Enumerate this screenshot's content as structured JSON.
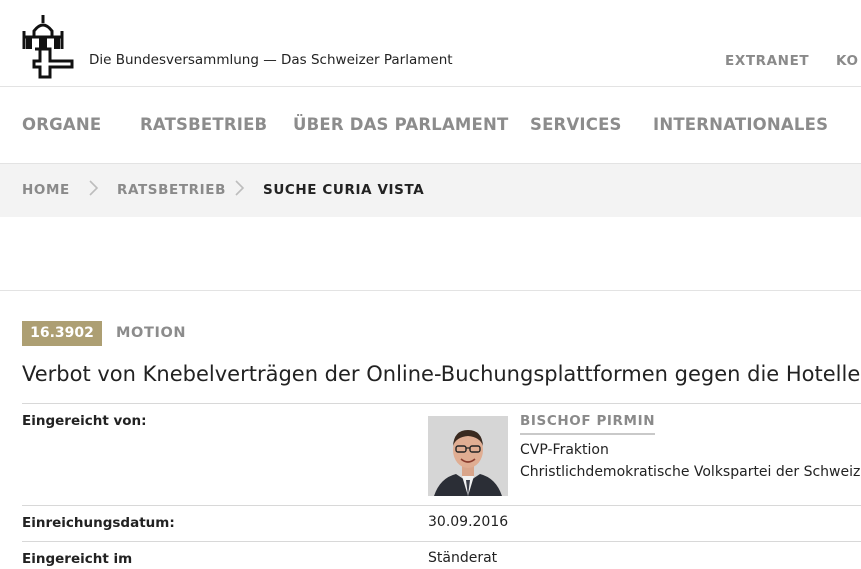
{
  "header": {
    "site_title": "Die Bundesversammlung — Das Schweizer Parlament",
    "utility_links": [
      "EXTRANET",
      "KO"
    ]
  },
  "main_nav": [
    "ORGANE",
    "RATSBETRIEB",
    "ÜBER DAS PARLAMENT",
    "SERVICES",
    "INTERNATIONALES"
  ],
  "breadcrumb": {
    "items": [
      "HOME",
      "RATSBETRIEB"
    ],
    "current": "SUCHE CURIA VISTA"
  },
  "business": {
    "number": "16.3902",
    "type": "MOTION",
    "title": "Verbot von Knebelverträgen der Online-Buchungsplattformen gegen die Hotellerie"
  },
  "details": {
    "submitted_by_label": "Eingereicht von:",
    "submitter": {
      "name": "BISCHOF PIRMIN",
      "faction": "CVP-Fraktion",
      "party": "Christlichdemokratische Volkspartei der Schweiz"
    },
    "date_label": "Einreichungsdatum:",
    "date_value": "30.09.2016",
    "council_label": "Eingereicht im",
    "council_value": "Ständerat"
  },
  "colors": {
    "badge": "#ad9f73",
    "nav_text": "#8c8c8c",
    "breadcrumb_bg": "#f3f3f3"
  }
}
